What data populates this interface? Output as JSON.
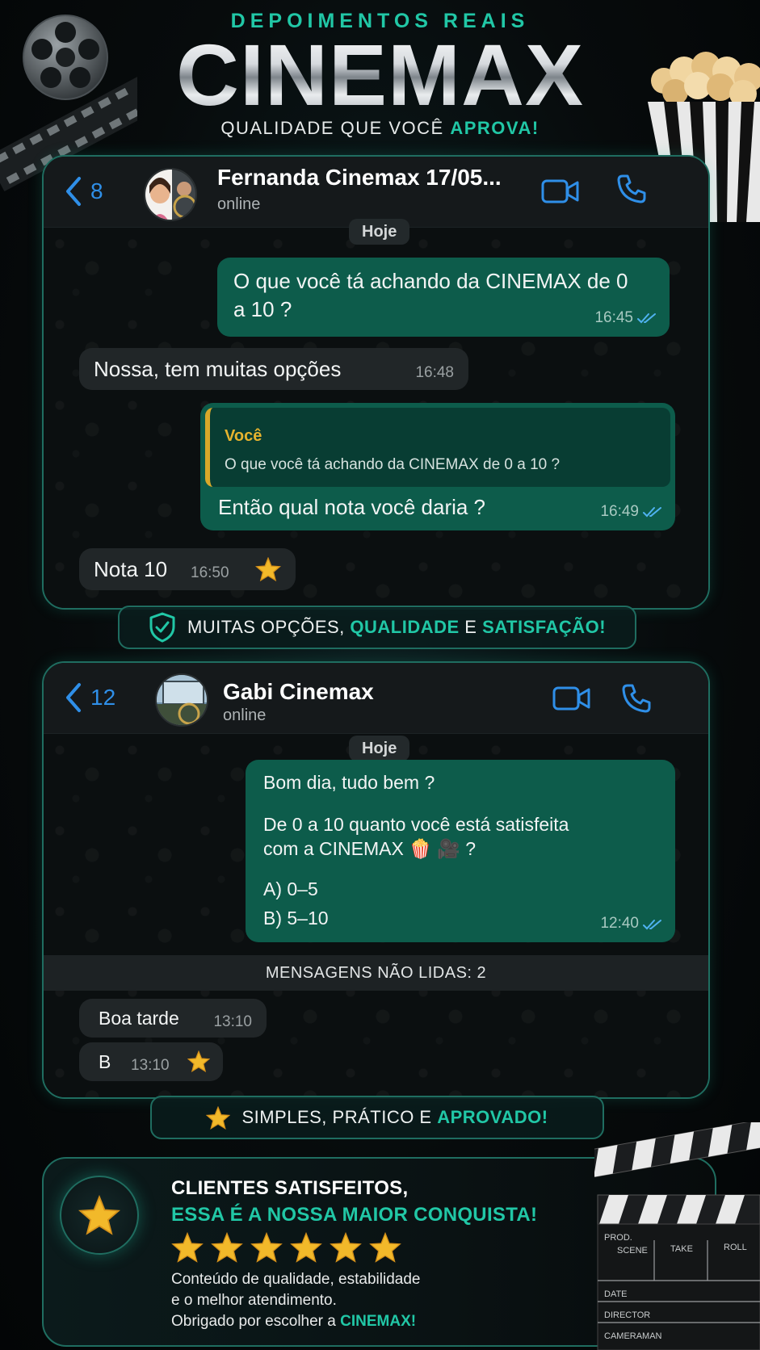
{
  "header": {
    "kicker": "DEPOIMENTOS REAIS",
    "logo": "CINEMAX",
    "tagline_prefix": "QUALIDADE QUE VOCÊ ",
    "tagline_accent": "APROVA!"
  },
  "chat1": {
    "back_count": "8",
    "contact_name": "Fernanda Cinemax 17/05...",
    "status": "online",
    "day": "Hoje",
    "messages": [
      {
        "type": "out",
        "text": "O que você tá achando da CINEMAX de 0 a 10 ?",
        "time": "16:45"
      },
      {
        "type": "in",
        "text": "Nossa, tem muitas opções",
        "time": "16:48"
      },
      {
        "type": "out-reply",
        "quote_author": "Você",
        "quote_text": "O que você tá achando da CINEMAX de 0 a 10 ?",
        "text": "Então qual nota você daria ?",
        "time": "16:49"
      },
      {
        "type": "in",
        "text": "Nota 10",
        "time": "16:50",
        "emoji": "⭐"
      }
    ]
  },
  "pill1": {
    "prefix": "MUITAS OPÇÕES, ",
    "accent1": "QUALIDADE",
    "mid": " E ",
    "accent2": "SATISFAÇÃO!"
  },
  "chat2": {
    "back_count": "12",
    "contact_name": "Gabi Cinemax",
    "status": "online",
    "day": "Hoje",
    "poll": {
      "line1": "Bom dia, tudo bem ?",
      "line2": "De 0 a 10 quanto você está satisfeita",
      "line3": "com a CINEMAX 🍿 🎥 ?",
      "option_a": "A) 0–5",
      "option_b": "B) 5–10",
      "time": "12:40"
    },
    "unread": "MENSAGENS NÃO LIDAS: 2",
    "replies": [
      {
        "text": "Boa tarde",
        "time": "13:10"
      },
      {
        "text": "B",
        "time": "13:10",
        "emoji": "⭐"
      }
    ]
  },
  "pill2": {
    "prefix": "SIMPLES, PRÁTICO E ",
    "accent": "APROVADO!"
  },
  "satisfaction": {
    "title": "CLIENTES SATISFEITOS,",
    "subtitle": "ESSA É A NOSSA MAIOR CONQUISTA!",
    "rating_stars": 6,
    "body_line1": "Conteúdo de qualidade, estabilidade",
    "body_line2": "e o melhor atendimento.",
    "body_line3_prefix": "Obrigado por escolher a ",
    "body_line3_accent": "CINEMAX!"
  },
  "clapper": {
    "prod": "PROD.",
    "scene": "SCENE",
    "take": "TAKE",
    "roll": "ROLL",
    "date": "DATE",
    "director": "DIRECTOR",
    "cameraman": "CAMERAMAN"
  },
  "colors": {
    "accent": "#21c7a6",
    "outgoing_bubble": "#0d5c4b",
    "incoming_bubble": "#212628",
    "ios_blue": "#2f8fe8",
    "gold": "#e6b32e"
  }
}
